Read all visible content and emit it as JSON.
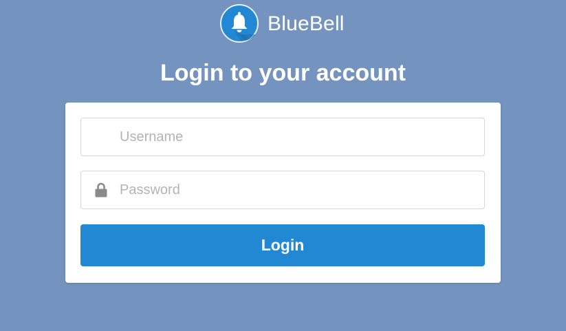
{
  "brand": {
    "name": "BlueBell",
    "logo_icon": "bell-icon",
    "logo_color": "#2388d4"
  },
  "page": {
    "title": "Login to your account",
    "background_color": "#7494bf"
  },
  "form": {
    "username": {
      "value": "",
      "placeholder": "Username"
    },
    "password": {
      "value": "",
      "placeholder": "Password",
      "icon": "lock-icon"
    },
    "login_label": "Login",
    "button_color": "#2388d4"
  }
}
